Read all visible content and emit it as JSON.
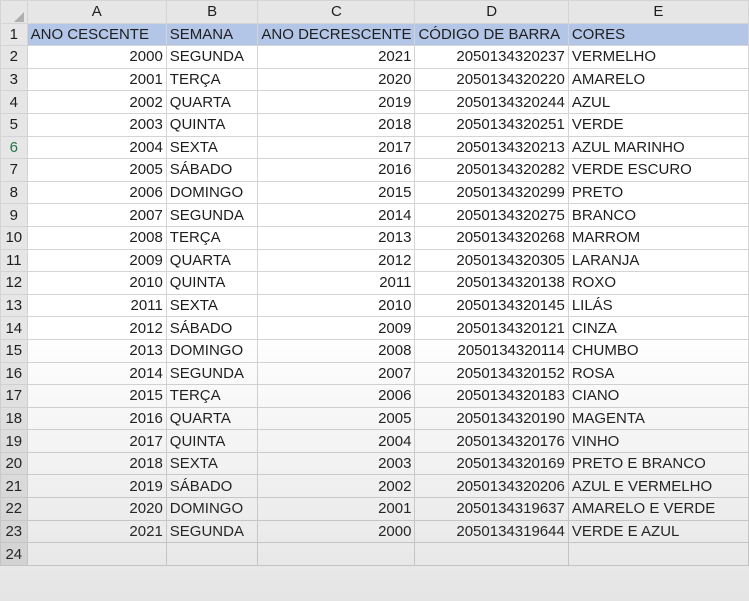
{
  "columns": [
    "A",
    "B",
    "C",
    "D",
    "E"
  ],
  "header": [
    "ANO CESCENTE",
    "SEMANA",
    "ANO DECRESCENTE",
    "CÓDIGO DE BARRA",
    "CORES"
  ],
  "rows": [
    [
      "2000",
      "SEGUNDA",
      "2021",
      "2050134320237",
      "VERMELHO"
    ],
    [
      "2001",
      "TERÇA",
      "2020",
      "2050134320220",
      "AMARELO"
    ],
    [
      "2002",
      "QUARTA",
      "2019",
      "2050134320244",
      "AZUL"
    ],
    [
      "2003",
      "QUINTA",
      "2018",
      "2050134320251",
      "VERDE"
    ],
    [
      "2004",
      "SEXTA",
      "2017",
      "2050134320213",
      "AZUL MARINHO"
    ],
    [
      "2005",
      "SÁBADO",
      "2016",
      "2050134320282",
      "VERDE ESCURO"
    ],
    [
      "2006",
      "DOMINGO",
      "2015",
      "2050134320299",
      "PRETO"
    ],
    [
      "2007",
      "SEGUNDA",
      "2014",
      "2050134320275",
      "BRANCO"
    ],
    [
      "2008",
      "TERÇA",
      "2013",
      "2050134320268",
      "MARROM"
    ],
    [
      "2009",
      "QUARTA",
      "2012",
      "2050134320305",
      "LARANJA"
    ],
    [
      "2010",
      "QUINTA",
      "2011",
      "2050134320138",
      "ROXO"
    ],
    [
      "2011",
      "SEXTA",
      "2010",
      "2050134320145",
      "LILÁS"
    ],
    [
      "2012",
      "SÁBADO",
      "2009",
      "2050134320121",
      "CINZA"
    ],
    [
      "2013",
      "DOMINGO",
      "2008",
      "2050134320114",
      "CHUMBO"
    ],
    [
      "2014",
      "SEGUNDA",
      "2007",
      "2050134320152",
      "ROSA"
    ],
    [
      "2015",
      "TERÇA",
      "2006",
      "2050134320183",
      "CIANO"
    ],
    [
      "2016",
      "QUARTA",
      "2005",
      "2050134320190",
      "MAGENTA"
    ],
    [
      "2017",
      "QUINTA",
      "2004",
      "2050134320176",
      "VINHO"
    ],
    [
      "2018",
      "SEXTA",
      "2003",
      "2050134320169",
      "PRETO E BRANCO"
    ],
    [
      "2019",
      "SÁBADO",
      "2002",
      "2050134320206",
      "AZUL E VERMELHO"
    ],
    [
      "2020",
      "DOMINGO",
      "2001",
      "2050134319637",
      "AMARELO E VERDE"
    ],
    [
      "2021",
      "SEGUNDA",
      "2000",
      "2050134319644",
      "VERDE E AZUL"
    ]
  ],
  "empty_row_number": "24",
  "active_row": "6",
  "colors": {
    "header_fill": "#b4c6e7",
    "heading_fill": "#e6e6e6",
    "gridline": "#d4d4d4",
    "active_row_number": "#217346"
  }
}
